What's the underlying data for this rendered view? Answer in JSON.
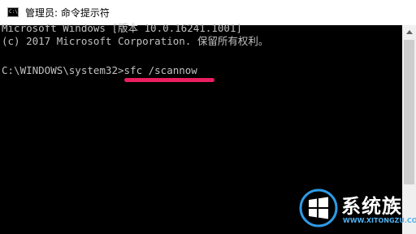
{
  "window": {
    "title": "管理员: 命令提示符",
    "icon": "cmd-console-icon",
    "icon_text": "C:\\"
  },
  "console": {
    "line1": "Microsoft Windows [版本 10.0.16241.1001]",
    "line2": "(c) 2017 Microsoft Corporation. 保留所有权利。",
    "prompt": "C:\\WINDOWS\\system32>",
    "command": "sfc /scannow"
  },
  "annotation": {
    "underline_color": "#ea1f5f"
  },
  "watermark": {
    "brand": "系统族",
    "url": "WWW.XITONGZU.COM",
    "logo_icon": "windows-logo-icon"
  },
  "colors": {
    "console_bg": "#000000",
    "console_text": "#c0c0c0"
  }
}
